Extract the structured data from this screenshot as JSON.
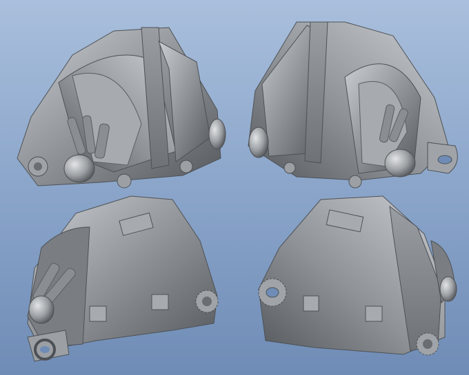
{
  "scene": {
    "background_top": "#a9bfdc",
    "background_bottom": "#6f8cb6",
    "model_color": "#8f9397",
    "model_highlight": "#c9ccd0",
    "model_shadow": "#55595d"
  },
  "views": [
    {
      "name": "top-left-view"
    },
    {
      "name": "top-right-view"
    },
    {
      "name": "bottom-left-view"
    },
    {
      "name": "bottom-right-view"
    }
  ]
}
